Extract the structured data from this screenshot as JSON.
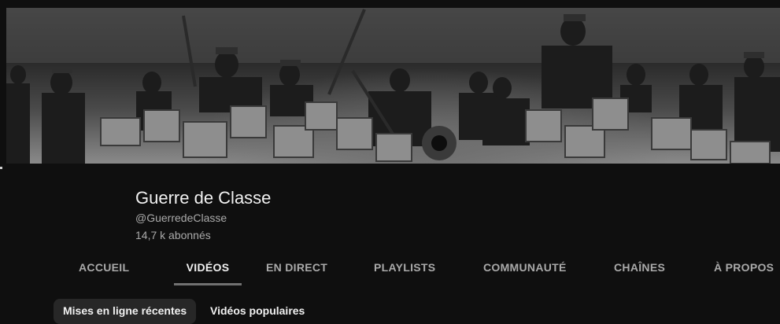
{
  "channel": {
    "name": "Guerre de Classe",
    "handle": "@GuerredeClasse",
    "subscribers": "14,7 k abonnés"
  },
  "tabs": [
    {
      "label": "ACCUEIL",
      "active": false
    },
    {
      "label": "VIDÉOS",
      "active": true
    },
    {
      "label": "EN DIRECT",
      "active": false
    },
    {
      "label": "PLAYLISTS",
      "active": false
    },
    {
      "label": "COMMUNAUTÉ",
      "active": false
    },
    {
      "label": "CHAÎNES",
      "active": false
    },
    {
      "label": "À PROPOS",
      "active": false
    }
  ],
  "filters": [
    {
      "label": "Mises en ligne récentes",
      "active": true
    },
    {
      "label": "Vidéos populaires",
      "active": false
    }
  ],
  "colors": {
    "background": "#0f0f0f",
    "text_primary": "#f1f1f1",
    "text_secondary": "#aaaaaa",
    "chip_active": "#272727"
  }
}
